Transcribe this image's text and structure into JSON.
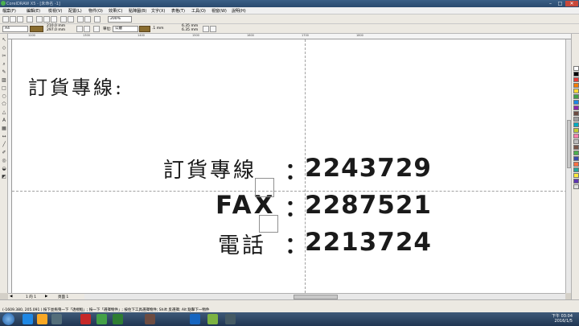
{
  "window": {
    "title": "CorelDRAW X5 - [未命名 -1]",
    "controls": [
      "–",
      "□",
      "✕"
    ]
  },
  "menu": [
    "檔案(F)",
    "編輯(E)",
    "檢視(V)",
    "配置(L)",
    "物件(O)",
    "效果(C)",
    "點陣圖(B)",
    "文字(X)",
    "表格(T)",
    "工具(O)",
    "視窗(W)",
    "說明(H)"
  ],
  "toolbar1": {
    "zoom": "200%"
  },
  "toolbar2": {
    "page_size": "A4",
    "width": "210.0 mm",
    "height": "297.0 mm",
    "units_label": "單位:",
    "units": "公釐",
    "nudge": ".1 mm",
    "dup_x": "6.35 mm",
    "dup_y": "6.35 mm"
  },
  "ruler": {
    "top_labels": [
      "1200",
      "1300",
      "1400",
      "1500",
      "1600",
      "1700",
      "1800"
    ]
  },
  "canvas": {
    "heading": "訂貨專線:",
    "row1_label": "訂貨專線",
    "row1_colon": "：",
    "row1_number": "2243729",
    "row2_label": "FAX",
    "row2_colon": "：",
    "row2_number": "2287521",
    "row3_label": "電話",
    "row3_colon": "：",
    "row3_number": "2213724"
  },
  "page_nav": {
    "position": "1 的 1",
    "page_tab": "頁面 1"
  },
  "status": {
    "text": "(-1609.380, 205.091 )  按下並拖曳一下「透視框」; 按一下「選擇物件」; 按住下工具選擇物件; Shift 反選擇; Alt 點擊下一物件"
  },
  "taskbar": {
    "time": "下午 03:04",
    "date": "2016/1/5"
  },
  "palette": [
    "#ffffff",
    "#000000",
    "#e53935",
    "#f57c00",
    "#fdd835",
    "#43a047",
    "#1e88e5",
    "#8e24aa",
    "#6d4c41",
    "#9e9e9e",
    "#00acc1",
    "#c0ca33",
    "#ff80ab",
    "#bdbdbd",
    "#795548",
    "#4caf50",
    "#3949ab",
    "#ff7043",
    "#26a69a",
    "#ffeb3b",
    "#5e35b1",
    "#e0e0e0"
  ]
}
